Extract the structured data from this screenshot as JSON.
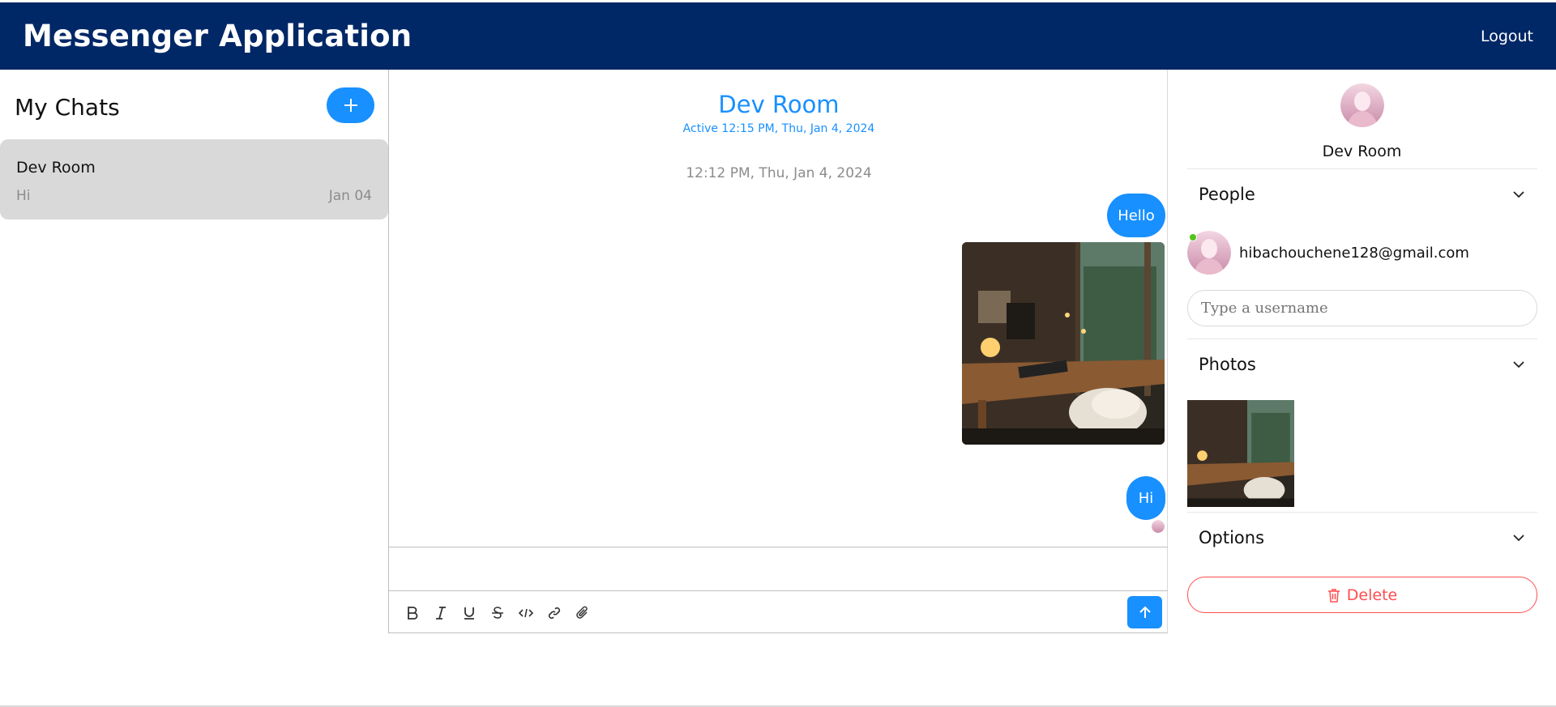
{
  "header": {
    "title": "Messenger Application",
    "logout_label": "Logout"
  },
  "sidebar": {
    "heading": "My Chats",
    "add_icon": "plus-icon",
    "chats": [
      {
        "name": "Dev Room",
        "preview": "Hi",
        "date": "Jan 04"
      }
    ]
  },
  "conversation": {
    "title": "Dev Room",
    "active": "Active 12:15 PM, Thu, Jan 4, 2024",
    "timestamp": "12:12 PM, Thu, Jan 4, 2024",
    "messages": [
      "Hello",
      "Hi"
    ],
    "toolbar_icons": [
      "bold-icon",
      "italic-icon",
      "underline-icon",
      "strikethrough-icon",
      "code-icon",
      "link-icon",
      "paperclip-icon"
    ],
    "send_icon": "arrow-up-icon"
  },
  "details": {
    "name": "Dev Room",
    "people_label": "People",
    "member_email": "hibachouchene128@gmail.com",
    "username_placeholder": "Type a username",
    "photos_label": "Photos",
    "options_label": "Options",
    "delete_label": "Delete"
  },
  "colors": {
    "header": "#002766",
    "accent": "#1890ff",
    "danger": "#ff4d4f",
    "online": "#52c41a"
  }
}
